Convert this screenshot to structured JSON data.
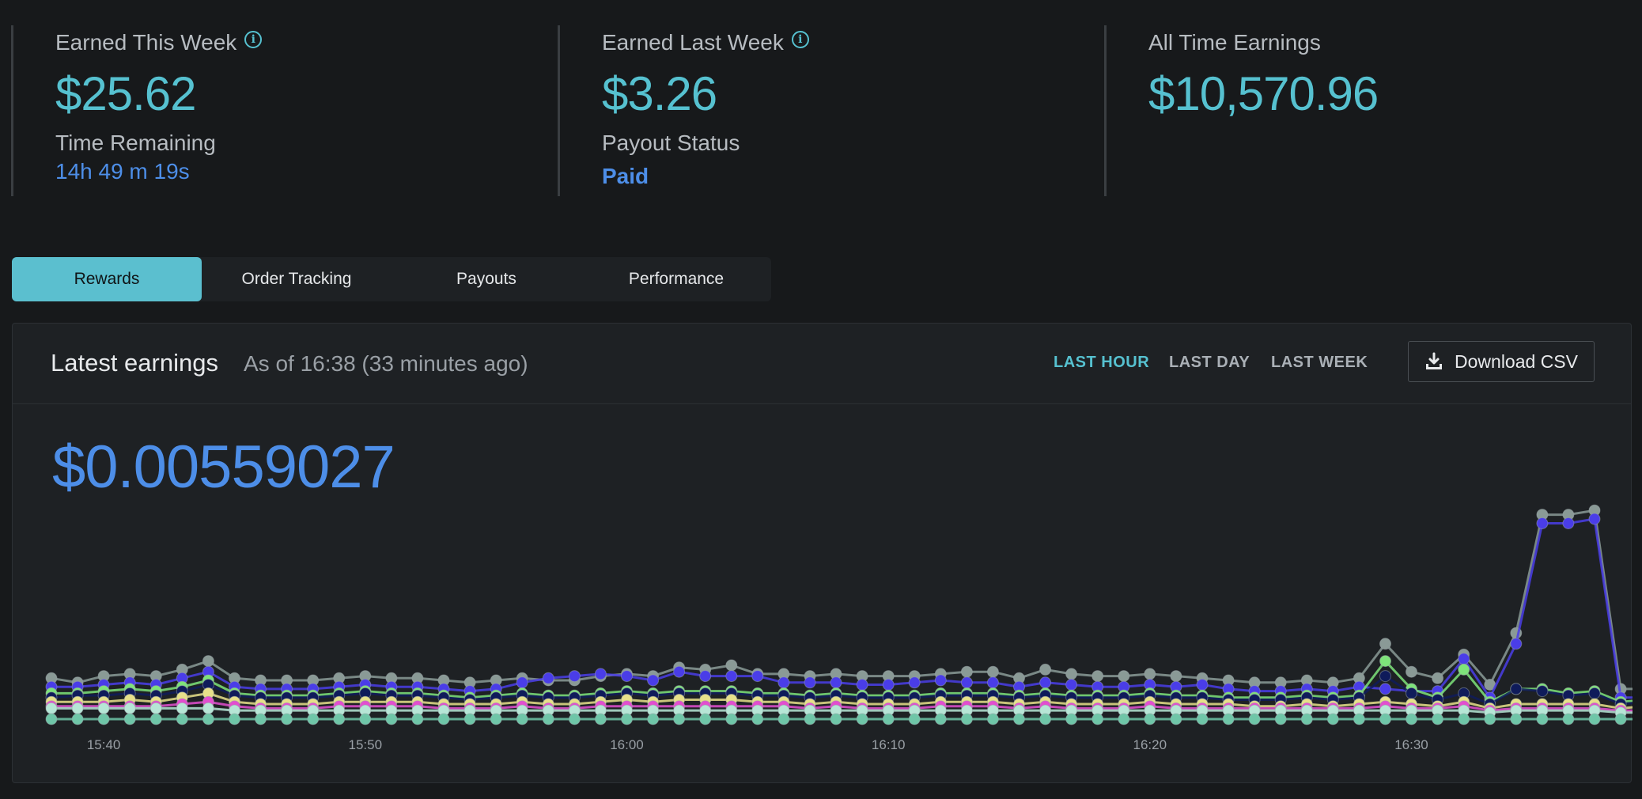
{
  "stats": {
    "this_week": {
      "label": "Earned This Week",
      "value": "$25.62",
      "sub_label": "Time Remaining",
      "sub_value": "14h 49 m 19s"
    },
    "last_week": {
      "label": "Earned Last Week",
      "value": "$3.26",
      "sub_label": "Payout Status",
      "sub_value": "Paid"
    },
    "all_time": {
      "label": "All Time Earnings",
      "value": "$10,570.96"
    }
  },
  "tabs": [
    "Rewards",
    "Order Tracking",
    "Payouts",
    "Performance"
  ],
  "active_tab": "Rewards",
  "panel": {
    "title": "Latest earnings",
    "subtitle": "As of 16:38 (33 minutes ago)",
    "ranges": [
      "LAST HOUR",
      "LAST DAY",
      "LAST WEEK"
    ],
    "active_range": "LAST HOUR",
    "download_label": "Download CSV",
    "big_value": "$0.00559027"
  },
  "colors": {
    "accent": "#56c1d0",
    "blue": "#4d8ee8",
    "background": "#17191b",
    "panel": "#1e2124"
  },
  "icons": {
    "info": "info-icon",
    "download": "download-icon"
  },
  "chart_data": {
    "type": "line",
    "x_tick_labels": [
      "15:40",
      "15:50",
      "16:00",
      "16:10",
      "16:20",
      "16:30"
    ],
    "x_start": "15:38",
    "x_end": "16:37",
    "point_interval_minutes": 1,
    "y_range": [
      0,
      1
    ],
    "y_axis_visible": false,
    "grid": false,
    "legend": "none",
    "series": [
      {
        "color": "#8a9a96",
        "values": [
          0.19,
          0.17,
          0.2,
          0.21,
          0.2,
          0.23,
          0.27,
          0.19,
          0.18,
          0.18,
          0.18,
          0.19,
          0.2,
          0.19,
          0.19,
          0.18,
          0.17,
          0.18,
          0.19,
          0.18,
          0.18,
          0.2,
          0.21,
          0.2,
          0.24,
          0.23,
          0.25,
          0.21,
          0.21,
          0.2,
          0.21,
          0.2,
          0.2,
          0.2,
          0.21,
          0.22,
          0.22,
          0.19,
          0.23,
          0.21,
          0.2,
          0.2,
          0.21,
          0.2,
          0.19,
          0.18,
          0.17,
          0.17,
          0.18,
          0.17,
          0.19,
          0.35,
          0.22,
          0.19,
          0.3,
          0.16,
          0.4,
          0.95,
          0.95,
          0.97,
          0.14,
          0.14
        ]
      },
      {
        "color": "#4a3de8",
        "values": [
          0.15,
          0.15,
          0.16,
          0.17,
          0.16,
          0.19,
          0.22,
          0.15,
          0.14,
          0.14,
          0.14,
          0.15,
          0.16,
          0.15,
          0.15,
          0.14,
          0.13,
          0.14,
          0.17,
          0.19,
          0.2,
          0.21,
          0.2,
          0.18,
          0.22,
          0.2,
          0.2,
          0.2,
          0.17,
          0.17,
          0.17,
          0.16,
          0.16,
          0.17,
          0.18,
          0.17,
          0.17,
          0.15,
          0.17,
          0.16,
          0.15,
          0.15,
          0.16,
          0.15,
          0.16,
          0.14,
          0.13,
          0.13,
          0.14,
          0.13,
          0.15,
          0.14,
          0.13,
          0.13,
          0.28,
          0.1,
          0.35,
          0.91,
          0.91,
          0.93,
          0.1,
          0.1
        ]
      },
      {
        "color": "#7ee37a",
        "values": [
          0.12,
          0.12,
          0.13,
          0.14,
          0.13,
          0.15,
          0.18,
          0.12,
          0.11,
          0.11,
          0.11,
          0.12,
          0.13,
          0.12,
          0.12,
          0.11,
          0.1,
          0.11,
          0.12,
          0.11,
          0.11,
          0.12,
          0.13,
          0.12,
          0.13,
          0.13,
          0.13,
          0.12,
          0.12,
          0.11,
          0.12,
          0.11,
          0.11,
          0.11,
          0.12,
          0.12,
          0.12,
          0.11,
          0.12,
          0.11,
          0.11,
          0.11,
          0.12,
          0.11,
          0.11,
          0.1,
          0.1,
          0.1,
          0.11,
          0.1,
          0.11,
          0.27,
          0.14,
          0.1,
          0.23,
          0.08,
          0.14,
          0.14,
          0.12,
          0.13,
          0.08,
          0.09
        ]
      },
      {
        "color": "#0f1b5a",
        "values": [
          0.1,
          0.11,
          0.11,
          0.12,
          0.11,
          0.13,
          0.16,
          0.11,
          0.1,
          0.1,
          0.1,
          0.11,
          0.12,
          0.11,
          0.11,
          0.1,
          0.09,
          0.1,
          0.11,
          0.1,
          0.1,
          0.11,
          0.12,
          0.11,
          0.12,
          0.12,
          0.12,
          0.11,
          0.11,
          0.1,
          0.11,
          0.1,
          0.1,
          0.1,
          0.11,
          0.11,
          0.11,
          0.1,
          0.11,
          0.1,
          0.1,
          0.1,
          0.11,
          0.1,
          0.1,
          0.09,
          0.09,
          0.09,
          0.1,
          0.09,
          0.1,
          0.2,
          0.12,
          0.09,
          0.12,
          0.07,
          0.14,
          0.13,
          0.11,
          0.12,
          0.07,
          0.08
        ]
      },
      {
        "color": "#e7e08a",
        "values": [
          0.08,
          0.08,
          0.08,
          0.09,
          0.08,
          0.1,
          0.12,
          0.08,
          0.07,
          0.07,
          0.07,
          0.08,
          0.08,
          0.08,
          0.08,
          0.07,
          0.07,
          0.07,
          0.08,
          0.07,
          0.07,
          0.08,
          0.09,
          0.08,
          0.09,
          0.09,
          0.09,
          0.08,
          0.08,
          0.07,
          0.08,
          0.07,
          0.07,
          0.07,
          0.08,
          0.08,
          0.08,
          0.07,
          0.08,
          0.07,
          0.07,
          0.07,
          0.08,
          0.07,
          0.07,
          0.07,
          0.06,
          0.06,
          0.07,
          0.06,
          0.07,
          0.08,
          0.07,
          0.06,
          0.08,
          0.05,
          0.07,
          0.07,
          0.07,
          0.07,
          0.05,
          0.06
        ]
      },
      {
        "color": "#e24ecf",
        "values": [
          0.06,
          0.06,
          0.06,
          0.06,
          0.06,
          0.07,
          0.08,
          0.06,
          0.05,
          0.05,
          0.05,
          0.06,
          0.06,
          0.06,
          0.06,
          0.05,
          0.05,
          0.05,
          0.06,
          0.05,
          0.05,
          0.06,
          0.06,
          0.06,
          0.06,
          0.06,
          0.06,
          0.06,
          0.06,
          0.05,
          0.06,
          0.05,
          0.05,
          0.05,
          0.06,
          0.06,
          0.06,
          0.05,
          0.06,
          0.05,
          0.05,
          0.05,
          0.06,
          0.05,
          0.05,
          0.05,
          0.05,
          0.05,
          0.05,
          0.05,
          0.05,
          0.06,
          0.05,
          0.05,
          0.06,
          0.04,
          0.05,
          0.05,
          0.05,
          0.05,
          0.04,
          0.04
        ]
      },
      {
        "color": "#b6e6d6",
        "values": [
          0.05,
          0.05,
          0.05,
          0.05,
          0.05,
          0.05,
          0.05,
          0.04,
          0.04,
          0.04,
          0.04,
          0.04,
          0.04,
          0.04,
          0.04,
          0.04,
          0.04,
          0.04,
          0.04,
          0.04,
          0.04,
          0.04,
          0.04,
          0.04,
          0.04,
          0.04,
          0.04,
          0.04,
          0.04,
          0.04,
          0.04,
          0.04,
          0.04,
          0.04,
          0.04,
          0.04,
          0.04,
          0.04,
          0.04,
          0.04,
          0.04,
          0.04,
          0.04,
          0.04,
          0.04,
          0.04,
          0.04,
          0.04,
          0.04,
          0.04,
          0.04,
          0.04,
          0.04,
          0.04,
          0.04,
          0.03,
          0.04,
          0.04,
          0.04,
          0.04,
          0.03,
          0.03
        ]
      },
      {
        "color": "#6fc6a8",
        "values": [
          0,
          0,
          0,
          0,
          0,
          0,
          0,
          0,
          0,
          0,
          0,
          0,
          0,
          0,
          0,
          0,
          0,
          0,
          0,
          0,
          0,
          0,
          0,
          0,
          0,
          0,
          0,
          0,
          0,
          0,
          0,
          0,
          0,
          0,
          0,
          0,
          0,
          0,
          0,
          0,
          0,
          0,
          0,
          0,
          0,
          0,
          0,
          0,
          0,
          0,
          0,
          0,
          0,
          0,
          0,
          0,
          0,
          0,
          0,
          0,
          0,
          0
        ]
      }
    ]
  }
}
